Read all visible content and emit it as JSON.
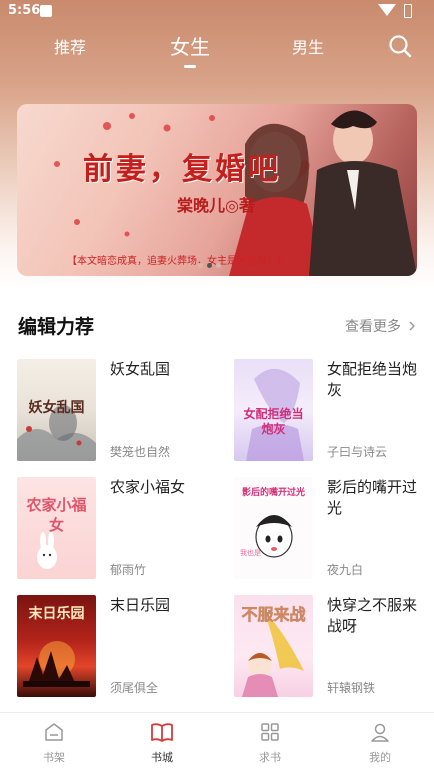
{
  "status_bar": {
    "time": "5:56"
  },
  "nav": {
    "tabs": [
      {
        "label": "推荐"
      },
      {
        "label": "女生"
      },
      {
        "label": "男生"
      }
    ],
    "active_tab": "女生",
    "search_icon": "search-icon"
  },
  "banner": {
    "title": "前妻，复婚吧",
    "author": "棠晚儿◎著",
    "tagline": "【本文暗恋成真，追妻火葬场，女主是大佬哦！】",
    "slide_count": 3,
    "active_slide": 2
  },
  "section": {
    "title": "编辑力荐",
    "more_label": "查看更多",
    "books": [
      {
        "title": "妖女乱国",
        "author": "樊笼也自然",
        "cover_text": "妖女乱国"
      },
      {
        "title": "女配拒绝当炮灰",
        "author": "子曰与诗云",
        "cover_text": "女配拒绝当炮灰"
      },
      {
        "title": "农家小福女",
        "author": "郁雨竹",
        "cover_text": "农家小福女"
      },
      {
        "title": "影后的嘴开过光",
        "author": "夜九白",
        "cover_text": "影后的嘴开过光"
      },
      {
        "title": "末日乐园",
        "author": "须尾俱全",
        "cover_text": "末日乐园"
      },
      {
        "title": "快穿之不服来战呀",
        "author": "轩辕钢铁",
        "cover_text": "不服来战"
      }
    ]
  },
  "bottom_nav": {
    "items": [
      {
        "label": "书架",
        "icon": "bookshelf-icon"
      },
      {
        "label": "书城",
        "icon": "book-city-icon"
      },
      {
        "label": "求书",
        "icon": "grid-icon"
      },
      {
        "label": "我的",
        "icon": "profile-icon"
      }
    ],
    "active": "书城"
  },
  "colors": {
    "accent_red": "#d43c3c",
    "header_gradient_top": "#c98a6d"
  }
}
